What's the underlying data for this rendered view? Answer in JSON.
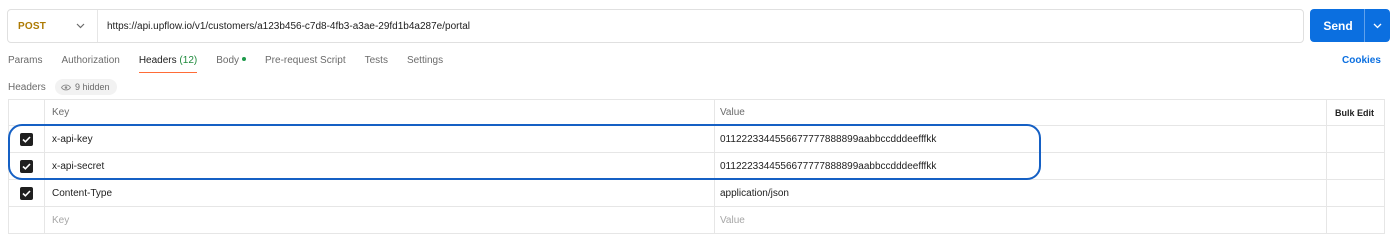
{
  "request": {
    "method": "POST",
    "url": "https://api.upflow.io/v1/customers/a123b456-c7d8-4fb3-a3ae-29fd1b4a287e/portal",
    "send_label": "Send",
    "method_color": "#ad7a03",
    "send_color": "#0b6fe0"
  },
  "tabs": [
    {
      "label": "Params",
      "active": false
    },
    {
      "label": "Authorization",
      "active": false
    },
    {
      "label": "Headers",
      "count": "(12)",
      "active": true
    },
    {
      "label": "Body",
      "dot": true,
      "active": false
    },
    {
      "label": "Pre-request Script",
      "active": false
    },
    {
      "label": "Tests",
      "active": false
    },
    {
      "label": "Settings",
      "active": false
    }
  ],
  "cookies_label": "Cookies",
  "headers_section": {
    "label": "Headers",
    "hidden_label": "9 hidden",
    "hidden_icon": "eye-icon"
  },
  "table": {
    "columns": {
      "key": "Key",
      "value": "Value",
      "bulk_edit": "Bulk Edit"
    },
    "rows": [
      {
        "checked": true,
        "key": "x-api-key",
        "value": "0112223344556677777888899aabbccdddeefffkk"
      },
      {
        "checked": true,
        "key": "x-api-secret",
        "value": "0112223344556677777888899aabbccdddeefffkk"
      },
      {
        "checked": true,
        "key": "Content-Type",
        "value": "application/json"
      }
    ],
    "new_row": {
      "key_placeholder": "Key",
      "value_placeholder": "Value"
    }
  },
  "annotation_color": "#1560c4"
}
